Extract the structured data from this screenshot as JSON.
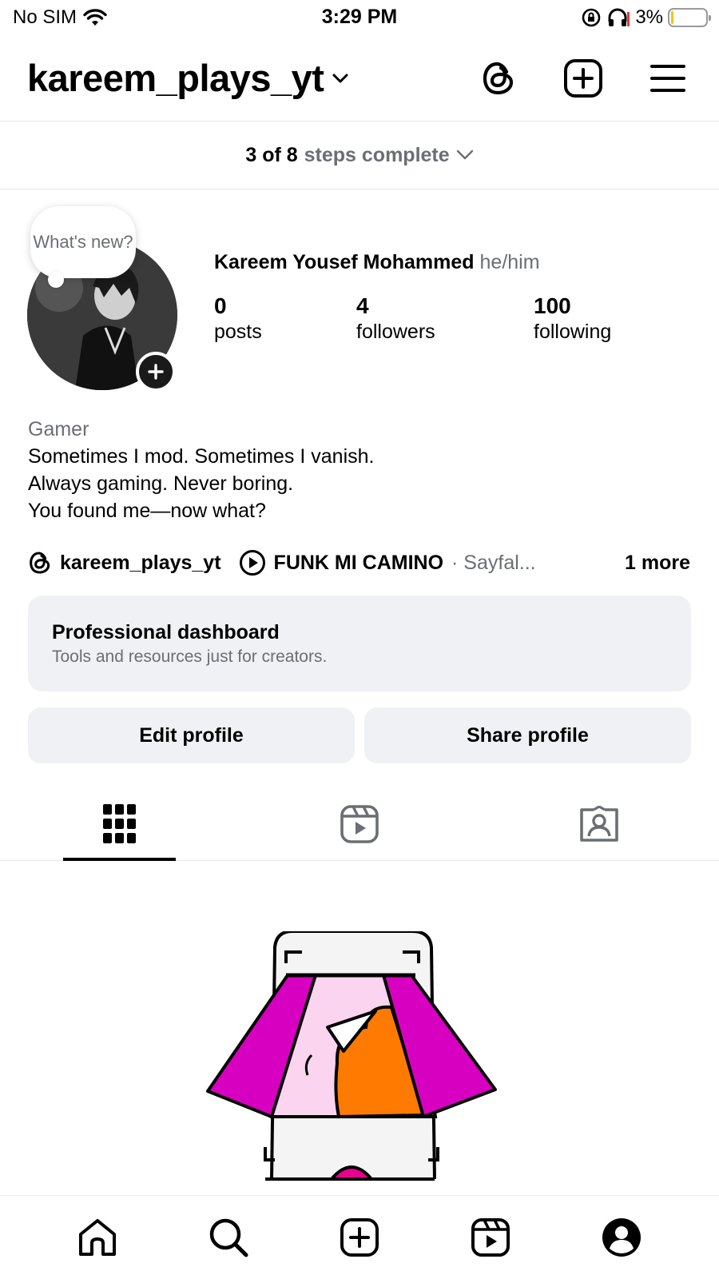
{
  "status_bar": {
    "carrier": "No SIM",
    "time": "3:29 PM",
    "battery_percent": "3%",
    "battery_level": 0.03,
    "icons": [
      "wifi-icon",
      "orientation-lock-icon",
      "headphones-icon",
      "battery-icon"
    ]
  },
  "header": {
    "username": "kareem_plays_yt",
    "icons": [
      "threads-icon",
      "create-icon",
      "menu-icon"
    ]
  },
  "steps": {
    "count": "3 of 8",
    "label": "steps complete"
  },
  "profile": {
    "note_bubble": "What's new?",
    "full_name": "Kareem Yousef Mohammed",
    "pronouns": "he/him",
    "stats": [
      {
        "value": "0",
        "label": "posts"
      },
      {
        "value": "4",
        "label": "followers"
      },
      {
        "value": "100",
        "label": "following"
      }
    ],
    "category": "Gamer",
    "bio_lines": [
      "Sometimes I mod. Sometimes I vanish.",
      "Always gaming. Never boring.",
      "You found me—now what?"
    ]
  },
  "links": {
    "threads_handle": "kareem_plays_yt",
    "music_title": "FUNK MI CAMINO",
    "music_artist": "· Sayfal...",
    "more": "1 more"
  },
  "dashboard": {
    "title": "Professional dashboard",
    "subtitle": "Tools and resources just for creators."
  },
  "buttons": {
    "edit": "Edit profile",
    "share": "Share profile"
  },
  "tabs": [
    "grid-icon",
    "reels-icon",
    "tagged-icon"
  ],
  "bottom_nav": [
    "home-icon",
    "search-icon",
    "create-icon",
    "reels-icon",
    "profile-icon"
  ],
  "colors": {
    "accent_magenta": "#d800c0",
    "accent_orange": "#ff7a00",
    "light_pink": "#fbd4ef",
    "secondary_text": "#6b6e73",
    "button_bg": "#eff1f4"
  }
}
